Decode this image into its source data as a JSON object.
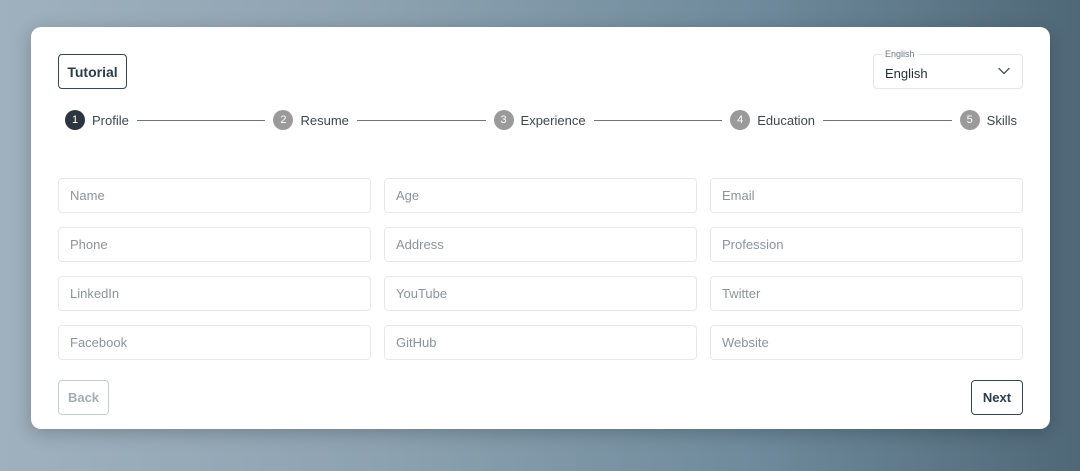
{
  "header": {
    "tutorial_label": "Tutorial",
    "language": {
      "legend": "English",
      "selected": "English",
      "icon": "chevron-down-icon"
    }
  },
  "stepper": {
    "steps": [
      {
        "number": "1",
        "label": "Profile",
        "active": true
      },
      {
        "number": "2",
        "label": "Resume",
        "active": false
      },
      {
        "number": "3",
        "label": "Experience",
        "active": false
      },
      {
        "number": "4",
        "label": "Education",
        "active": false
      },
      {
        "number": "5",
        "label": "Skills",
        "active": false
      }
    ]
  },
  "form": {
    "fields": [
      {
        "placeholder": "Name",
        "value": ""
      },
      {
        "placeholder": "Age",
        "value": ""
      },
      {
        "placeholder": "Email",
        "value": ""
      },
      {
        "placeholder": "Phone",
        "value": ""
      },
      {
        "placeholder": "Address",
        "value": ""
      },
      {
        "placeholder": "Profession",
        "value": ""
      },
      {
        "placeholder": "LinkedIn",
        "value": ""
      },
      {
        "placeholder": "YouTube",
        "value": ""
      },
      {
        "placeholder": "Twitter",
        "value": ""
      },
      {
        "placeholder": "Facebook",
        "value": ""
      },
      {
        "placeholder": "GitHub",
        "value": ""
      },
      {
        "placeholder": "Website",
        "value": ""
      }
    ]
  },
  "footer": {
    "back_label": "Back",
    "next_label": "Next"
  },
  "colors": {
    "primary": "#2b3640",
    "inactive_step": "#9a9a9a",
    "disabled": "#a3adb5"
  }
}
